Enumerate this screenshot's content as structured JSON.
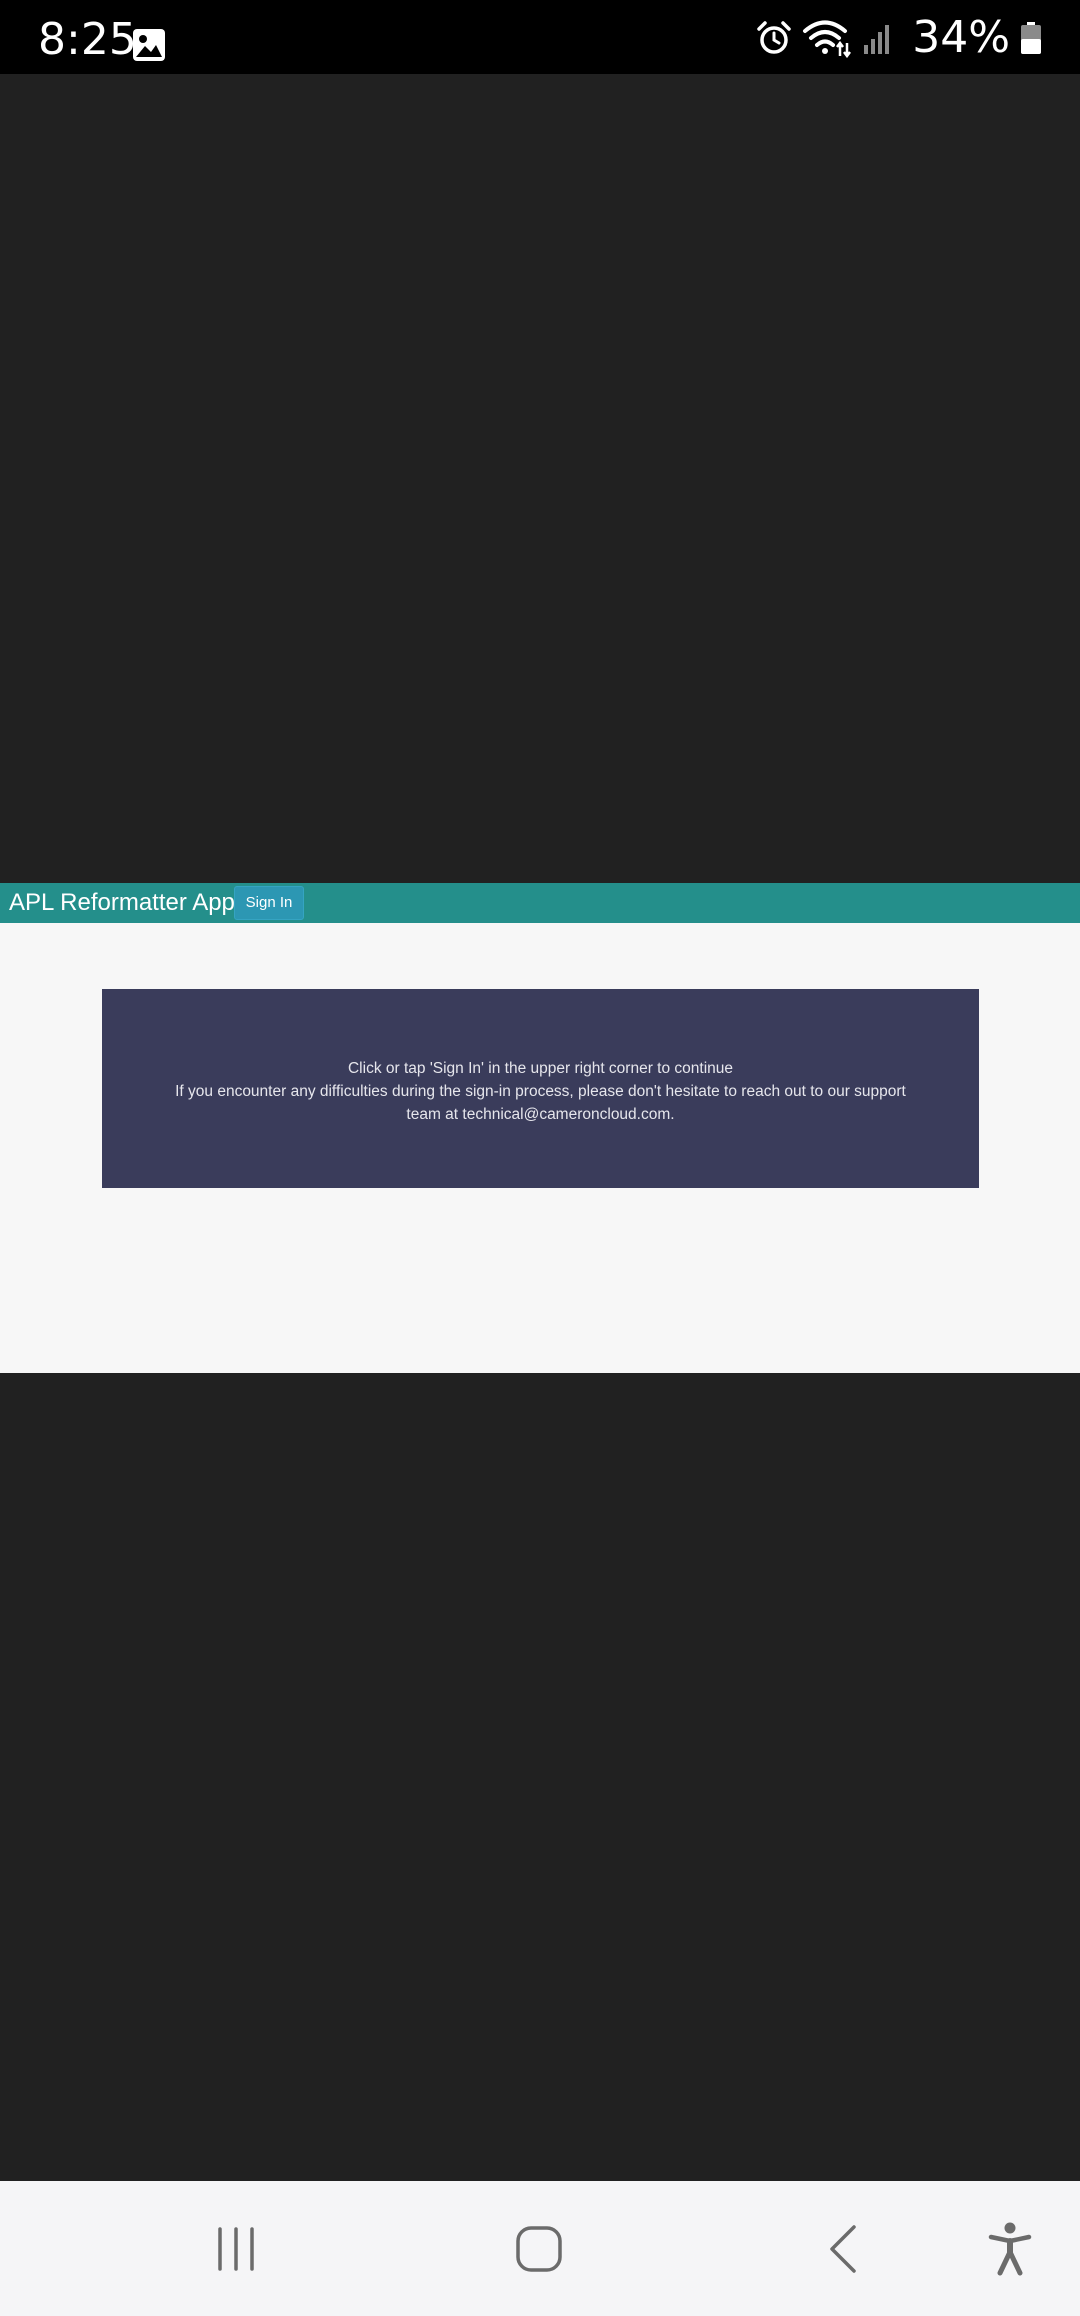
{
  "status_bar": {
    "time": "8:25",
    "battery_percent": "34%",
    "icons": [
      "gallery-icon",
      "alarm-icon",
      "wifi-icon",
      "signal-icon",
      "battery-icon"
    ]
  },
  "app": {
    "title": "APL Reformatter App",
    "sign_in_label": "Sign In",
    "message_line1": "Click or tap 'Sign In' in the upper right corner to continue",
    "message_line2": "If you encounter any difficulties during the sign-in process, please don't hesitate to reach out to our support team at technical@cameroncloud.com.",
    "colors": {
      "header": "#248f8b",
      "button": "#2c97b3",
      "panel": "#3a3c5b",
      "page_background": "#f7f7f7"
    }
  },
  "nav_bar": {
    "icons": [
      "recents-icon",
      "home-icon",
      "back-icon",
      "accessibility-icon"
    ]
  }
}
